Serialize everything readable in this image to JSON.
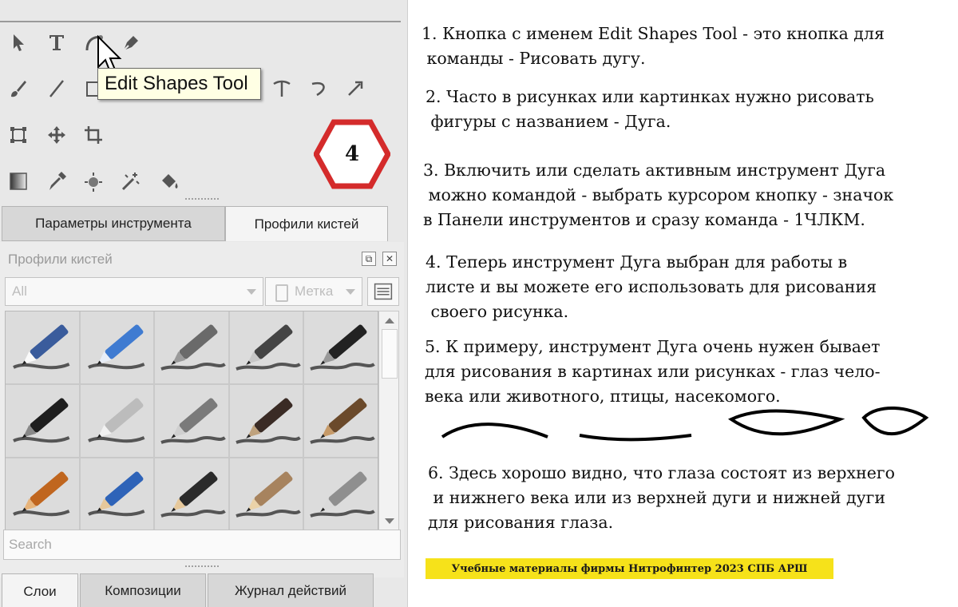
{
  "tooltip": {
    "text": "Edit Shapes Tool"
  },
  "badge": {
    "number": "4",
    "color": "#d42b2b"
  },
  "tools": {
    "row1": [
      "select-arrow-icon",
      "text-icon",
      "edit-shapes-arc-icon",
      "pen-nib-icon"
    ],
    "row2": [
      "brush-icon",
      "line-icon",
      "rectangle-icon",
      "text-path-icon",
      "curve-icon",
      "arrow-brush-icon"
    ],
    "row3": [
      "transform-icon",
      "move-icon",
      "crop-icon"
    ],
    "row4": [
      "gradient-icon",
      "eyedropper-icon",
      "color-picker-icon",
      "magic-wand-icon",
      "fill-bucket-icon"
    ]
  },
  "tabs_top": {
    "tool_params": "Параметры инструмента",
    "brush_profiles": "Профили кистей"
  },
  "brush_section": {
    "title": "Профили кистей",
    "filter_value": "All",
    "tag_value": "Метка",
    "search_placeholder": "Search",
    "brushes": [
      "eraser",
      "blue-eraser",
      "soft-eraser",
      "ink-pen-airbrush",
      "black-marker",
      "black-marker-2",
      "white-pencil",
      "grey-pencil",
      "dark-brush",
      "wooden-brush",
      "orange-brush",
      "blue-pencil",
      "dark-pencil",
      "wood-pencil",
      "silver-pen"
    ]
  },
  "tabs_bottom": {
    "layers": "Слои",
    "compositions": "Композиции",
    "history": "Журнал действий"
  },
  "notes": [
    "1. Кнопка с именем Edit Shapes Tool - это кнопка для\n команды - Рисовать дугу.",
    "2. Часто в рисунках или картинках нужно рисовать\n фигуры с названием - Дуга.",
    "3. Включить или сделать активным инструмент Дуга\n можно командой - выбрать курсором кнопку - значок\nв Панели инструментов и сразу команда - 1ЧЛКМ.",
    "4. Теперь инструмент Дуга выбран для работы в\nлисте и вы можете его использовать для рисования\n своего рисунка.",
    "5. К примеру, инструмент Дуга очень нужен бывает\nдля рисования в картинах или рисунках - глаз чело-\nвека или животного, птицы, насекомого.",
    "6. Здесь хорошо видно, что глаза состоят из верхнего\n и нижнего века или из верхней дуги и нижней дуги\nдля рисования глаза."
  ],
  "footer": "Учебные материалы фирмы Нитрофинтер 2023 СПБ АРШ",
  "colors": {
    "footer_bg": "#f6e21a",
    "panel_bg": "#e8e8e8"
  }
}
